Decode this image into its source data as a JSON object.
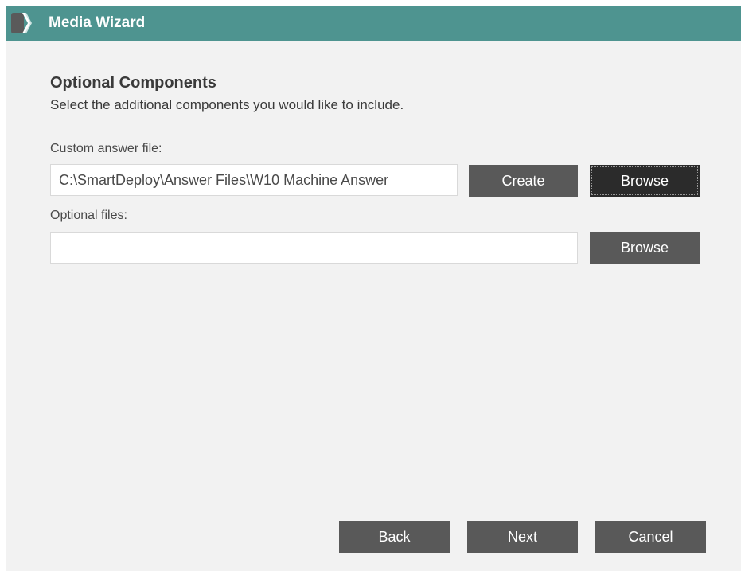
{
  "window": {
    "title": "Media Wizard",
    "logo_icon": "chevron-logo-icon",
    "titlebar_color": "#4e9490"
  },
  "page": {
    "heading": "Optional Components",
    "subheading": "Select the additional components you would like to include."
  },
  "answer_file": {
    "label": "Custom answer file:",
    "value": "C:\\SmartDeploy\\Answer Files\\W10 Machine Answer",
    "create_label": "Create",
    "browse_label": "Browse"
  },
  "optional_files": {
    "label": "Optional files:",
    "value": "",
    "browse_label": "Browse"
  },
  "footer": {
    "back_label": "Back",
    "next_label": "Next",
    "cancel_label": "Cancel"
  }
}
